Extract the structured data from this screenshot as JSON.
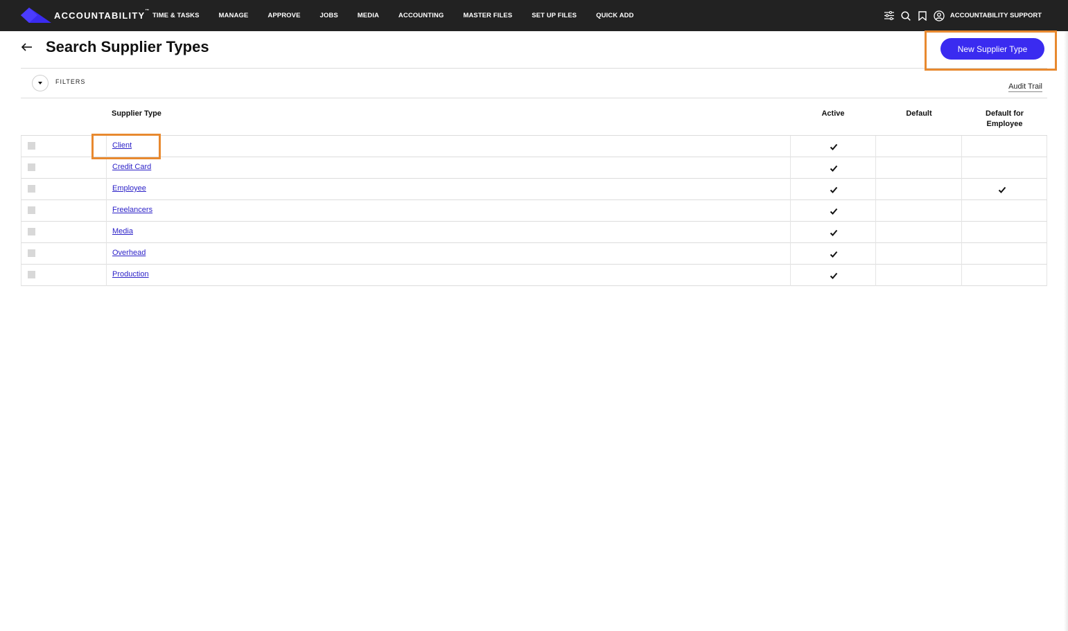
{
  "topbar": {
    "logo_text": "ACCOUNTABILITY",
    "logo_tm": "™",
    "nav": [
      "TIME & TASKS",
      "MANAGE",
      "APPROVE",
      "JOBS",
      "MEDIA",
      "ACCOUNTING",
      "MASTER FILES",
      "SET UP FILES",
      "QUICK ADD"
    ],
    "user_name": "ACCOUNTABILITY SUPPORT",
    "icons": [
      "sliders-icon",
      "search-icon",
      "bookmark-icon",
      "user-circle-icon"
    ]
  },
  "page": {
    "title": "Search Supplier Types",
    "new_button": "New Supplier Type",
    "filters_label": "FILTERS",
    "audit_trail": "Audit Trail"
  },
  "table": {
    "columns": {
      "supplier_type": "Supplier Type",
      "active": "Active",
      "default": "Default",
      "default_employee_line1": "Default for",
      "default_employee_line2": "Employee"
    },
    "rows": [
      {
        "name": "Client",
        "active": true,
        "default": false,
        "default_employee": false
      },
      {
        "name": "Credit Card",
        "active": true,
        "default": false,
        "default_employee": false
      },
      {
        "name": "Employee",
        "active": true,
        "default": false,
        "default_employee": true
      },
      {
        "name": "Freelancers",
        "active": true,
        "default": false,
        "default_employee": false
      },
      {
        "name": "Media",
        "active": true,
        "default": false,
        "default_employee": false
      },
      {
        "name": "Overhead",
        "active": true,
        "default": false,
        "default_employee": false
      },
      {
        "name": "Production",
        "active": true,
        "default": false,
        "default_employee": false
      }
    ]
  },
  "colors": {
    "topbar": "#222222",
    "accent": "#3a2bf0",
    "link": "#2a1fc7",
    "highlight": "#e8892f"
  }
}
